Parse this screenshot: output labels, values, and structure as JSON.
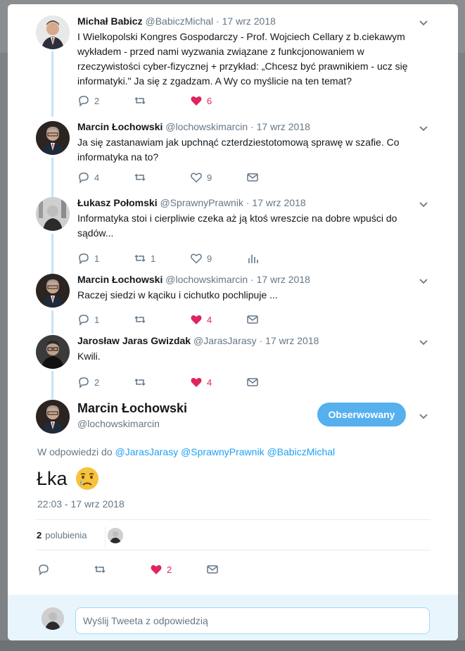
{
  "thread": [
    {
      "name": "Michał Babicz",
      "handle": "@BabiczMichal",
      "date": "17 wrz 2018",
      "text": "I Wielkopolski Kongres Gospodarczy - Prof. Wojciech Cellary z b.ciekawym wykładem - przed nami wyzwania związane z funkcjonowaniem w rzeczywistości cyber-fizycznej + przykład: „Chcesz być prawnikiem - ucz się informatyki.\" Ja się z zgadzam. A Wy co myślicie na ten temat?",
      "replies": "2",
      "retweets": "",
      "likes": "6",
      "liked": true
    },
    {
      "name": "Marcin Łochowski",
      "handle": "@lochowskimarcin",
      "date": "17 wrz 2018",
      "text": "Ja się zastanawiam jak upchnąć czterdziestotomową sprawę w szafie. Co informatyka na to?",
      "replies": "4",
      "retweets": "",
      "likes": "9",
      "liked": false
    },
    {
      "name": "Łukasz Połomski",
      "handle": "@SprawnyPrawnik",
      "date": "17 wrz 2018",
      "text": "Informatyka stoi i cierpliwie czeka aż ją ktoś wreszcie na dobre wpuści do sądów...",
      "replies": "1",
      "retweets": "1",
      "likes": "9",
      "liked": false
    },
    {
      "name": "Marcin Łochowski",
      "handle": "@lochowskimarcin",
      "date": "17 wrz 2018",
      "text": "Raczej siedzi w kąciku i cichutko pochlipuje ...",
      "replies": "1",
      "retweets": "",
      "likes": "4",
      "liked": true
    },
    {
      "name": "Jarosław Jaras Gwizdak",
      "handle": "@JarasJarasy",
      "date": "17 wrz 2018",
      "text": "Kwili.",
      "replies": "2",
      "retweets": "",
      "likes": "4",
      "liked": true
    }
  ],
  "main": {
    "name": "Marcin Łochowski",
    "handle": "@lochowskimarcin",
    "follow_label": "Obserwowany",
    "reply_prefix": "W odpowiedzi do",
    "mentions": [
      "@JarasJarasy",
      "@SprawnyPrawnik",
      "@BabiczMichal"
    ],
    "text": "Łka",
    "emoji": "crying-face",
    "timestamp": "22:03 - 17 wrz 2018",
    "likes_count": "2",
    "likes_label": "polubienia",
    "action_likes": "2"
  },
  "reply_box": {
    "placeholder": "Wyślij Tweeta z odpowiedzią"
  },
  "colors": {
    "accent": "#1da1f2",
    "like": "#e0245e",
    "follow_button": "#55b0ed",
    "thread_line": "#c4e4f7"
  }
}
